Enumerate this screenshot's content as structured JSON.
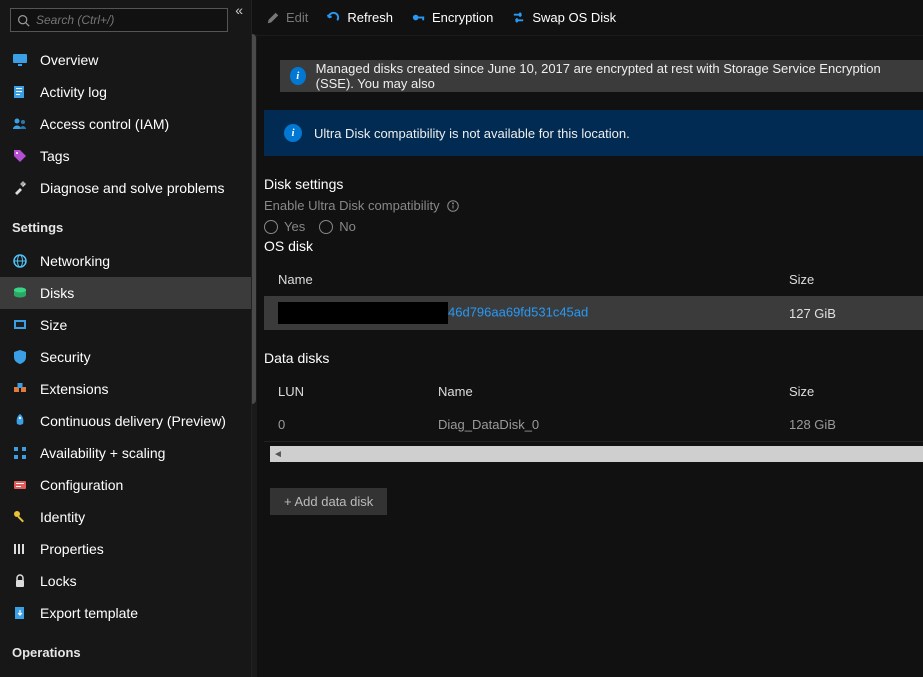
{
  "sidebar": {
    "search_placeholder": "Search (Ctrl+/)",
    "top_items": [
      {
        "label": "Overview"
      },
      {
        "label": "Activity log"
      },
      {
        "label": "Access control (IAM)"
      },
      {
        "label": "Tags"
      },
      {
        "label": "Diagnose and solve problems"
      }
    ],
    "settings_heading": "Settings",
    "settings_items": [
      {
        "label": "Networking"
      },
      {
        "label": "Disks",
        "active": true
      },
      {
        "label": "Size"
      },
      {
        "label": "Security"
      },
      {
        "label": "Extensions"
      },
      {
        "label": "Continuous delivery (Preview)"
      },
      {
        "label": "Availability + scaling"
      },
      {
        "label": "Configuration"
      },
      {
        "label": "Identity"
      },
      {
        "label": "Properties"
      },
      {
        "label": "Locks"
      },
      {
        "label": "Export template"
      }
    ],
    "operations_heading": "Operations"
  },
  "toolbar": {
    "edit": "Edit",
    "refresh": "Refresh",
    "encryption": "Encryption",
    "swap": "Swap OS Disk"
  },
  "banner": {
    "text": "Managed disks created since June 10, 2017 are encrypted at rest with Storage Service Encryption (SSE). You may also"
  },
  "notice": {
    "text": "Ultra Disk compatibility is not available for this location."
  },
  "disk_settings": {
    "title": "Disk settings",
    "enable_label": "Enable Ultra Disk compatibility",
    "yes": "Yes",
    "no": "No"
  },
  "os_disk": {
    "title": "OS disk",
    "col_name": "Name",
    "col_size": "Size",
    "row": {
      "name_suffix": "46d796aa69fd531c45ad",
      "size": "127 GiB"
    }
  },
  "data_disks": {
    "title": "Data disks",
    "col_lun": "LUN",
    "col_name": "Name",
    "col_size": "Size",
    "rows": [
      {
        "lun": "0",
        "name": "Diag_DataDisk_0",
        "size": "128 GiB"
      }
    ],
    "add_label": "+ Add data disk"
  }
}
